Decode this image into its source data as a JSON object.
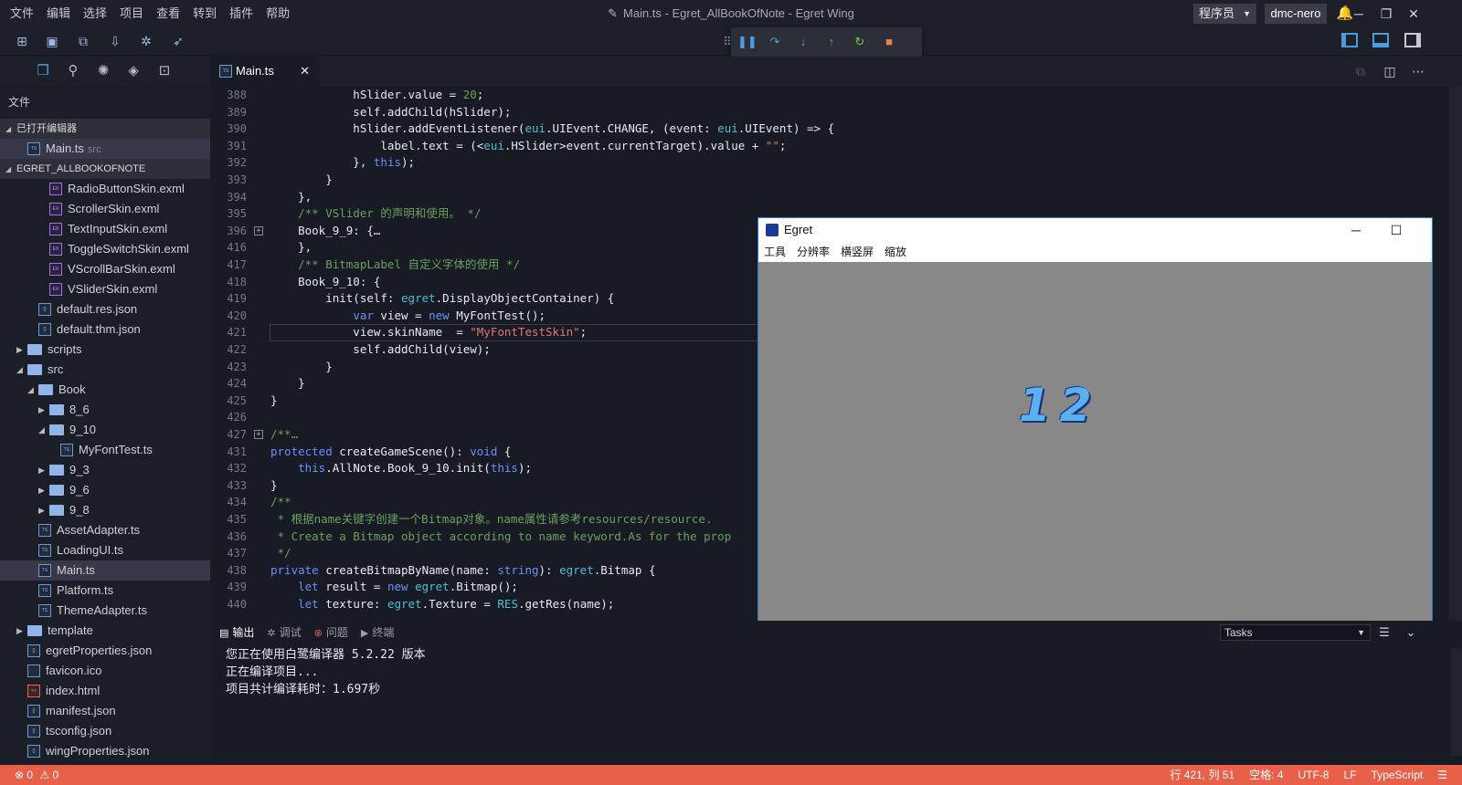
{
  "titlebar": {
    "menu": [
      "文件",
      "编辑",
      "选择",
      "项目",
      "查看",
      "转到",
      "插件",
      "帮助"
    ],
    "title": "Main.ts - Egret_AllBookOfNote - Egret Wing",
    "role": "程序员",
    "user": "dmc-nero"
  },
  "sidebar": {
    "title": "文件",
    "open_editors_label": "已打开编辑器",
    "open_editor": {
      "name": "Main.ts",
      "dir": "src"
    },
    "project_label": "EGRET_ALLBOOKOFNOTE",
    "tree": [
      {
        "name": "RadioButtonSkin.exml",
        "icon": "exml-file-icon",
        "depth": 4
      },
      {
        "name": "ScrollerSkin.exml",
        "icon": "exml-file-icon",
        "depth": 4
      },
      {
        "name": "TextInputSkin.exml",
        "icon": "exml-file-icon",
        "depth": 4
      },
      {
        "name": "ToggleSwitchSkin.exml",
        "icon": "exml-file-icon",
        "depth": 4
      },
      {
        "name": "VScrollBarSkin.exml",
        "icon": "exml-file-icon",
        "depth": 4
      },
      {
        "name": "VSliderSkin.exml",
        "icon": "exml-file-icon",
        "depth": 4
      },
      {
        "name": "default.res.json",
        "icon": "json-file-icon",
        "depth": 3
      },
      {
        "name": "default.thm.json",
        "icon": "json-file-icon",
        "depth": 3
      },
      {
        "name": "scripts",
        "icon": "folder-icon",
        "depth": 2,
        "twisty": "collapsed"
      },
      {
        "name": "src",
        "icon": "folder-open-icon",
        "depth": 2,
        "twisty": "expanded"
      },
      {
        "name": "Book",
        "icon": "folder-open-icon",
        "depth": 3,
        "twisty": "expanded"
      },
      {
        "name": "8_6",
        "icon": "folder-icon",
        "depth": 4,
        "twisty": "collapsed"
      },
      {
        "name": "9_10",
        "icon": "folder-open-icon",
        "depth": 4,
        "twisty": "expanded"
      },
      {
        "name": "MyFontTest.ts",
        "icon": "ts-file-icon",
        "depth": 5
      },
      {
        "name": "9_3",
        "icon": "folder-icon",
        "depth": 4,
        "twisty": "collapsed"
      },
      {
        "name": "9_6",
        "icon": "folder-icon",
        "depth": 4,
        "twisty": "collapsed"
      },
      {
        "name": "9_8",
        "icon": "folder-icon",
        "depth": 4,
        "twisty": "collapsed"
      },
      {
        "name": "AssetAdapter.ts",
        "icon": "ts-file-icon",
        "depth": 3
      },
      {
        "name": "LoadingUI.ts",
        "icon": "ts-file-icon",
        "depth": 3
      },
      {
        "name": "Main.ts",
        "icon": "ts-file-icon",
        "depth": 3,
        "selected": true
      },
      {
        "name": "Platform.ts",
        "icon": "ts-file-icon",
        "depth": 3
      },
      {
        "name": "ThemeAdapter.ts",
        "icon": "ts-file-icon",
        "depth": 3
      },
      {
        "name": "template",
        "icon": "folder-icon",
        "depth": 2,
        "twisty": "collapsed"
      },
      {
        "name": "egretProperties.json",
        "icon": "json-file-icon",
        "depth": 2
      },
      {
        "name": "favicon.ico",
        "icon": "file-icon",
        "depth": 2
      },
      {
        "name": "index.html",
        "icon": "html-file-icon",
        "depth": 2
      },
      {
        "name": "manifest.json",
        "icon": "json-file-icon",
        "depth": 2
      },
      {
        "name": "tsconfig.json",
        "icon": "json-file-icon",
        "depth": 2
      },
      {
        "name": "wingProperties.json",
        "icon": "json-file-icon",
        "depth": 2
      }
    ]
  },
  "editor": {
    "tab_label": "Main.ts",
    "lines": [
      {
        "n": "388",
        "code": "            hSlider.value = 20;"
      },
      {
        "n": "389",
        "code": "            self.addChild(hSlider);"
      },
      {
        "n": "390",
        "code": "            hSlider.addEventListener(eui.UIEvent.CHANGE, (event: eui.UIEvent) => {"
      },
      {
        "n": "391",
        "code": "                label.text = (<eui.HSlider>event.currentTarget).value + \"\";"
      },
      {
        "n": "392",
        "code": "            }, this);"
      },
      {
        "n": "393",
        "code": "        }"
      },
      {
        "n": "394",
        "code": "    },"
      },
      {
        "n": "395",
        "code": "    /** VSlider 的声明和使用。 */",
        "comment": true
      },
      {
        "n": "396",
        "code": "    Book_9_9: {…",
        "fold": true
      },
      {
        "n": "416",
        "code": "    },"
      },
      {
        "n": "417",
        "code": "    /** BitmapLabel 自定义字体的使用 */",
        "comment": true
      },
      {
        "n": "418",
        "code": "    Book_9_10: {"
      },
      {
        "n": "419",
        "code": "        init(self: egret.DisplayObjectContainer) {"
      },
      {
        "n": "420",
        "code": "            var view = new MyFontTest();"
      },
      {
        "n": "421",
        "code": "            view.skinName  = \"MyFontTestSkin\";",
        "current": true
      },
      {
        "n": "422",
        "code": "            self.addChild(view);"
      },
      {
        "n": "423",
        "code": "        }"
      },
      {
        "n": "424",
        "code": "    }"
      },
      {
        "n": "425",
        "code": "}"
      },
      {
        "n": "426",
        "code": ""
      },
      {
        "n": "427",
        "code": "/**…",
        "fold": true,
        "comment": true
      },
      {
        "n": "431",
        "code": "protected createGameScene(): void {"
      },
      {
        "n": "432",
        "code": "    this.AllNote.Book_9_10.init(this);"
      },
      {
        "n": "433",
        "code": "}"
      },
      {
        "n": "434",
        "code": "/**",
        "comment": true
      },
      {
        "n": "435",
        "code": " * 根据name关键字创建一个Bitmap对象。name属性请参考resources/resource.",
        "comment": true
      },
      {
        "n": "436",
        "code": " * Create a Bitmap object according to name keyword.As for the prop",
        "comment": true
      },
      {
        "n": "437",
        "code": " */",
        "comment": true
      },
      {
        "n": "438",
        "code": "private createBitmapByName(name: string): egret.Bitmap {"
      },
      {
        "n": "439",
        "code": "    let result = new egret.Bitmap();"
      },
      {
        "n": "440",
        "code": "    let texture: egret.Texture = RES.getRes(name);"
      }
    ]
  },
  "egret_window": {
    "title": "Egret",
    "menu": [
      "工具",
      "分辨率",
      "横竖屏",
      "缩放"
    ],
    "canvas_text": "12"
  },
  "panel": {
    "tabs": [
      "输出",
      "调试",
      "问题",
      "终端"
    ],
    "tasks_label": "Tasks",
    "output_lines": [
      "您正在使用白鹭编译器 5.2.22 版本",
      "正在编译项目...",
      "项目共计编译耗时：1.697秒"
    ]
  },
  "statusbar": {
    "errors": "0",
    "warnings": "0",
    "position": "行 421, 列 51",
    "indent": "空格: 4",
    "encoding": "UTF-8",
    "eol": "LF",
    "language": "TypeScript"
  },
  "colors": {
    "accent": "#4a9be0",
    "statusbar": "#e8604a",
    "keyword": "#6a8fff",
    "string": "#e07870",
    "comment": "#6aa060"
  }
}
